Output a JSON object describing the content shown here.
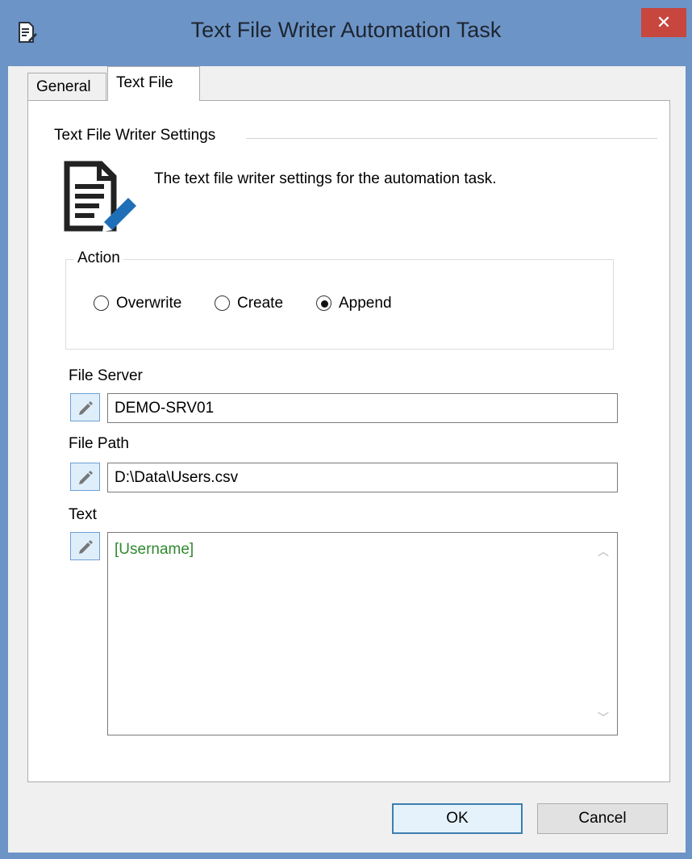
{
  "window": {
    "title": "Text File Writer Automation Task",
    "close_label": "✕"
  },
  "tabs": [
    {
      "label": "General",
      "selected": false
    },
    {
      "label": "Text File",
      "selected": true
    }
  ],
  "section": {
    "title": "Text File Writer Settings",
    "description": "The text file writer settings for the automation task.",
    "icon": "document-edit-icon"
  },
  "action": {
    "title": "Action",
    "options": [
      {
        "label": "Overwrite",
        "selected": false
      },
      {
        "label": "Create",
        "selected": false
      },
      {
        "label": "Append",
        "selected": true
      }
    ]
  },
  "fields": {
    "file_server": {
      "label": "File Server",
      "value": "DEMO-SRV01"
    },
    "file_path": {
      "label": "File Path",
      "value": "D:\\Data\\Users.csv"
    },
    "text": {
      "label": "Text",
      "value": "[Username]"
    }
  },
  "buttons": {
    "ok": "OK",
    "cancel": "Cancel"
  },
  "colors": {
    "titlebar": "#6d94c6",
    "close": "#c7463e",
    "token_text": "#2f8a2f",
    "edit_button": "#dfeefb"
  }
}
